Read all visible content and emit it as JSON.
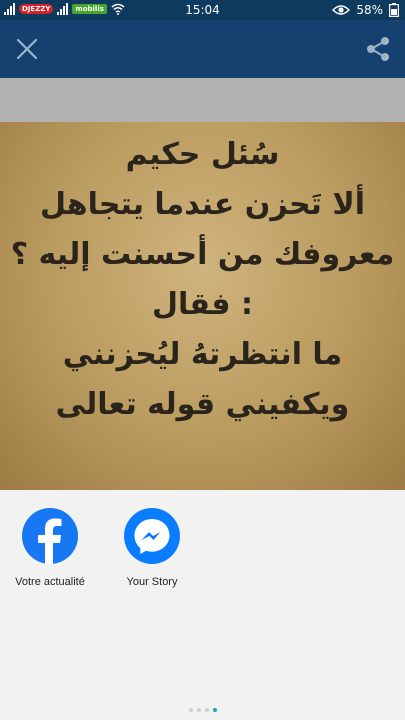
{
  "status_bar": {
    "carrier1": "DJEZZY",
    "carrier2": "mobilis",
    "time": "15:04",
    "battery": "58%"
  },
  "app_bar": {
    "close_icon": "close-icon",
    "share_icon": "share-icon",
    "background": "#154170"
  },
  "image": {
    "lines": [
      "سُئل حكيم",
      "ألا تَحزن عندما يتجاهل",
      "معروفك من أحسنت إليه ؟",
      ": فقال",
      "ما انتظرتهُ ليُحزنني",
      "ويكفيني قوله تعالى"
    ]
  },
  "share_sheet": {
    "targets": [
      {
        "label": "Votre actualité",
        "icon": "facebook-icon",
        "color": "#1877f2"
      },
      {
        "label": "Your Story",
        "icon": "messenger-icon",
        "color": "#0a7cff"
      }
    ],
    "page_count": 4,
    "active_page": 4
  }
}
